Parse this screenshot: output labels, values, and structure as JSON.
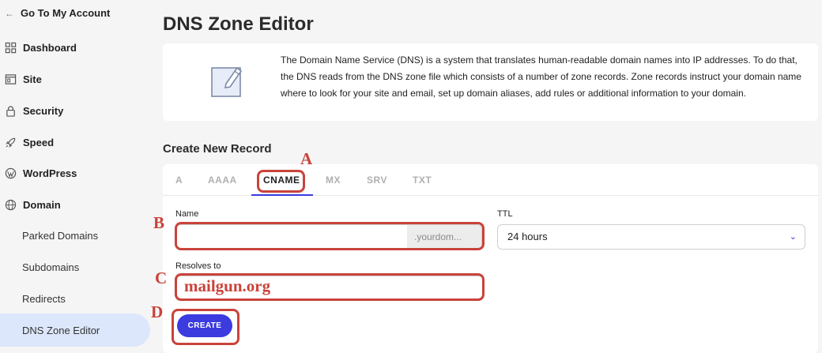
{
  "sidebar": {
    "back_label": "Go To My Account",
    "items": [
      {
        "label": "Dashboard",
        "icon": "grid-icon"
      },
      {
        "label": "Site",
        "icon": "site-icon"
      },
      {
        "label": "Security",
        "icon": "lock-icon"
      },
      {
        "label": "Speed",
        "icon": "rocket-icon"
      },
      {
        "label": "WordPress",
        "icon": "wordpress-icon"
      },
      {
        "label": "Domain",
        "icon": "globe-icon"
      }
    ],
    "sub_items": [
      "Parked Domains",
      "Subdomains",
      "Redirects",
      "DNS Zone Editor"
    ],
    "active_sub_item": "DNS Zone Editor"
  },
  "page": {
    "title": "DNS Zone Editor",
    "info_text": "The Domain Name Service (DNS) is a system that translates human-readable domain names into IP addresses. To do that, the DNS reads from the DNS zone file which consists of a number of zone records. Zone records instruct your domain name where to look for your site and email, set up domain aliases, add rules or additional information to your domain."
  },
  "form": {
    "section_title": "Create New Record",
    "tabs": [
      "A",
      "AAAA",
      "CNAME",
      "MX",
      "SRV",
      "TXT"
    ],
    "active_tab": "CNAME",
    "name_label": "Name",
    "name_value": "",
    "name_suffix": ".yourdom...",
    "ttl_label": "TTL",
    "ttl_value": "24 hours",
    "resolves_label": "Resolves to",
    "resolves_value": "mailgun.org",
    "create_label": "CREATE"
  },
  "annotations": {
    "letters": [
      "A",
      "B",
      "C",
      "D"
    ],
    "color": "#c9433b"
  },
  "colors": {
    "accent": "#3b3be0",
    "active_nav_bg": "#dde7fb"
  }
}
